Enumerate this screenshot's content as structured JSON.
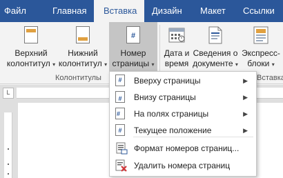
{
  "tabs": [
    "Файл",
    "Главная",
    "Вставка",
    "Дизайн",
    "Макет",
    "Ссылки"
  ],
  "ribbon": {
    "group_headers_footers": "Колонтитулы",
    "group_insert": "Вставка",
    "header_button": {
      "line1": "Верхний",
      "line2": "колонтитул"
    },
    "footer_button": {
      "line1": "Нижний",
      "line2": "колонтитул"
    },
    "page_number_button": {
      "line1": "Номер",
      "line2": "страницы"
    },
    "datetime_button": {
      "line1": "Дата и",
      "line2": "время"
    },
    "docinfo_button": {
      "line1": "Сведения о",
      "line2": "документе"
    },
    "quickparts_button": {
      "line1": "Экспресс-",
      "line2": "блоки"
    },
    "caret": "▾"
  },
  "ruler_corner": "L",
  "menu": {
    "items": [
      {
        "label": "Вверху страницы",
        "arrow": "▶"
      },
      {
        "label": "Внизу страницы",
        "arrow": "▶"
      },
      {
        "label": "На полях страницы",
        "arrow": "▶"
      },
      {
        "label": "Текущее положение",
        "arrow": "▶"
      },
      {
        "label": "Формат номеров страниц..."
      },
      {
        "label": "Удалить номера страниц"
      }
    ]
  },
  "icons": {
    "header": "page-header-icon",
    "footer": "page-footer-icon",
    "page_number": "page-number-icon",
    "datetime": "calendar-icon",
    "docinfo": "document-info-icon",
    "quickparts": "quick-parts-icon",
    "delete": "delete-x-icon"
  },
  "hash_glyph": "#",
  "colors": {
    "brand": "#2b579a",
    "accent": "#e0a040",
    "delete": "#d13438"
  }
}
